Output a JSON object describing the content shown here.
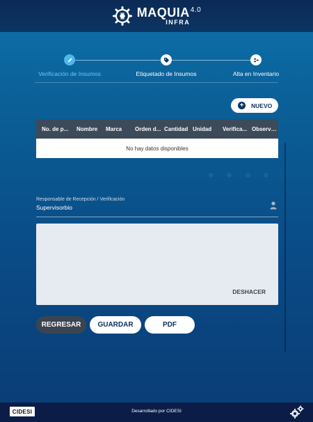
{
  "header": {
    "logo_main": "MAQUIA",
    "logo_sup": "4.0",
    "logo_sub": "INFRA"
  },
  "stepper": {
    "steps": [
      {
        "label": "Verificación de Insumos",
        "icon": "pencil-icon",
        "active": true
      },
      {
        "label": "Etiquetado de Insumos",
        "icon": "tag-icon",
        "active": false
      },
      {
        "label": "Alta en Inventario",
        "icon": "inventory-icon",
        "active": false
      }
    ]
  },
  "toolbar": {
    "new_label": "NUEVO",
    "new_icon": "plus-circle-icon"
  },
  "table": {
    "columns": [
      "No. de p...",
      "Nombre",
      "Marca",
      "Orden d...",
      "Cantidad",
      "Unidad",
      "Verifica...",
      "Observa..."
    ],
    "empty_text": "No hay datos disponibles"
  },
  "form": {
    "responsable_label": "Responsable de Recepción / Verificación",
    "responsable_value": "Supervisorbio",
    "responsable_icon": "person-icon"
  },
  "signature": {
    "undo_label": "DESHACER"
  },
  "actions": {
    "back_label": "REGRESAR",
    "save_label": "GUARDAR",
    "pdf_label": "PDF"
  },
  "footer": {
    "logo_text": "CIDESI",
    "credit_text": "Desarrollado por CIDESI",
    "settings_icon": "gears-icon"
  },
  "colors": {
    "header_bg": "#0b2a55",
    "accent": "#4fb6ee",
    "table_header_bg": "#3c4a5a",
    "dark_button": "#3b4550"
  }
}
